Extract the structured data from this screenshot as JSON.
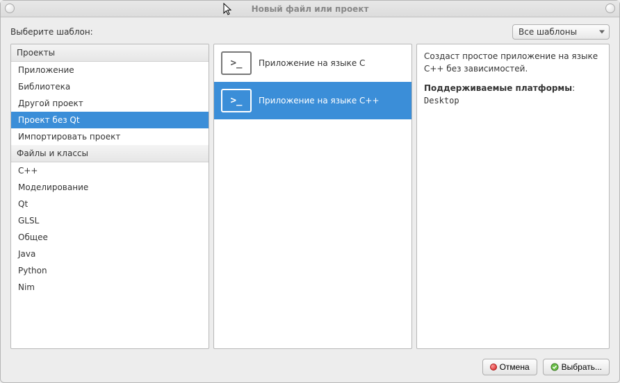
{
  "window": {
    "title": "Новый файл или проект"
  },
  "top": {
    "label": "Выберите шаблон:",
    "dropdown": "Все шаблоны"
  },
  "sidebar": {
    "header1": "Проекты",
    "items1": [
      "Приложение",
      "Библиотека",
      "Другой проект",
      "Проект без Qt",
      "Импортировать проект"
    ],
    "selected1": 3,
    "header2": "Файлы и классы",
    "items2": [
      "C++",
      "Моделирование",
      "Qt",
      "GLSL",
      "Общее",
      "Java",
      "Python",
      "Nim"
    ]
  },
  "templates": {
    "items": [
      {
        "label": "Приложение на языке C"
      },
      {
        "label": "Приложение на языке C++"
      }
    ],
    "selected": 1
  },
  "description": {
    "line1": "Создаст простое приложение на языке C++ без зависимостей.",
    "platforms_label": "Поддерживаемые платформы",
    "platforms_value": "Desktop"
  },
  "buttons": {
    "cancel": "Отмена",
    "choose": "Выбрать..."
  }
}
